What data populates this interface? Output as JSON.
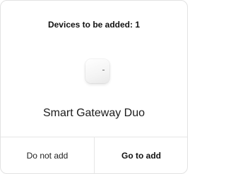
{
  "dialog": {
    "title": "Devices to be added: 1",
    "device": {
      "name": "Smart Gateway Duo",
      "icon": "gateway-device-icon"
    },
    "buttons": {
      "cancel_label": "Do not add",
      "confirm_label": "Go to add"
    }
  }
}
